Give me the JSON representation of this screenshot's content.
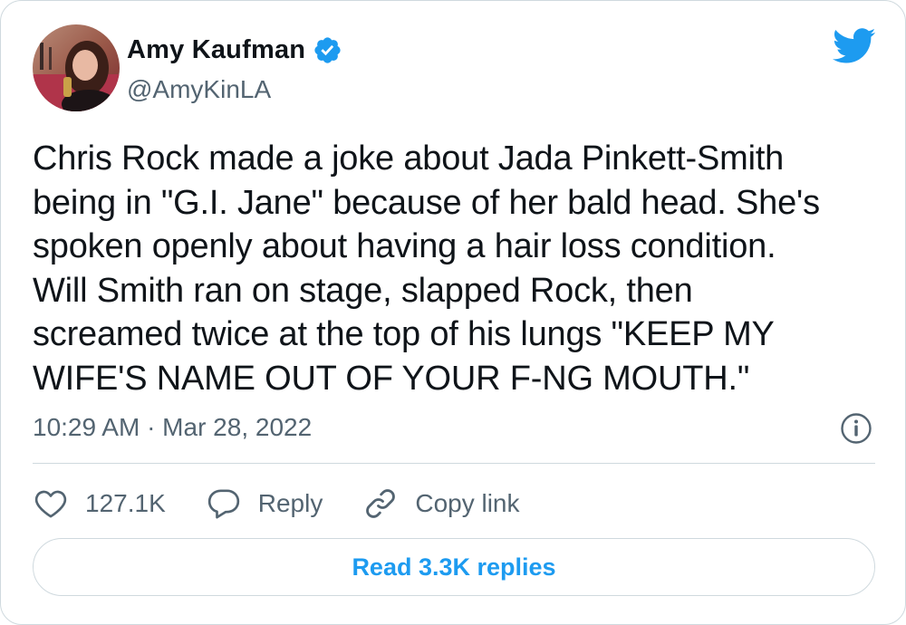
{
  "author": {
    "display_name": "Amy Kaufman",
    "handle": "@AmyKinLA",
    "verified": true
  },
  "brand": {
    "icon": "twitter-bird-icon",
    "color": "#1d9bf0"
  },
  "tweet": {
    "text": "Chris Rock made a joke about Jada Pinkett-Smith\nbeing in \"G.I. Jane\" because of her bald head. She's\nspoken openly about having a hair loss condition.\nWill Smith ran on stage, slapped Rock, then\nscreamed twice at the top of his lungs \"KEEP MY\nWIFE'S NAME OUT OF YOUR F-NG MOUTH.\"",
    "timestamp": "10:29 AM · Mar 28, 2022"
  },
  "actions": {
    "like_count": "127.1K",
    "reply_label": "Reply",
    "copy_link_label": "Copy link"
  },
  "read_replies_label": "Read 3.3K replies",
  "colors": {
    "text_primary": "#0f1419",
    "text_secondary": "#536471",
    "accent": "#1d9bf0",
    "border": "#cfd9de"
  }
}
